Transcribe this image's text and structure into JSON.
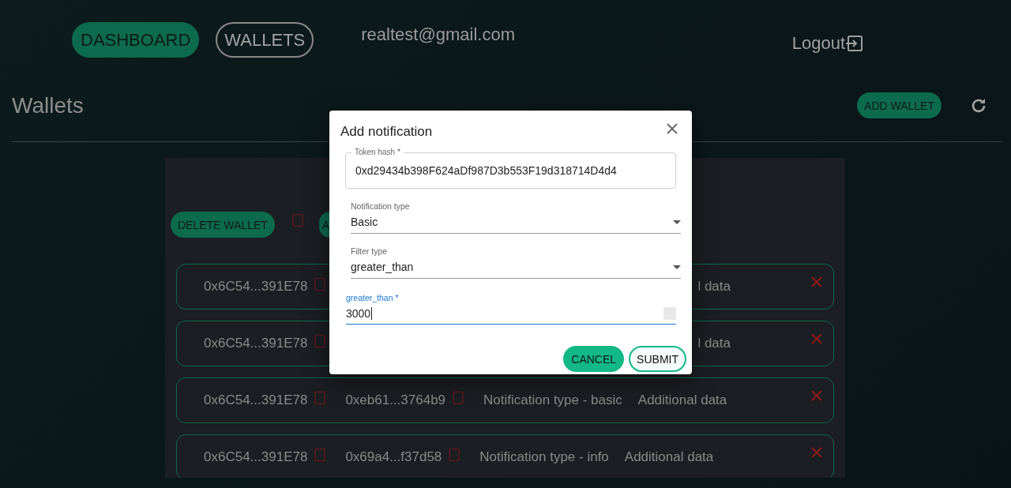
{
  "nav": {
    "buttons": [
      {
        "label": "DASHBOARD",
        "selected": true
      },
      {
        "label": "WALLETS",
        "selected": false
      }
    ],
    "email": "realtest@gmail.com",
    "logout": "Logout"
  },
  "page": {
    "title": "Wallets",
    "add_button": "ADD WALLET"
  },
  "toolbar": {
    "delete_button": "DELETE WALLET",
    "partial_button": "A"
  },
  "rows": [
    {
      "kind": "partial",
      "address": "0x6C54...391E78",
      "extra": "l data"
    },
    {
      "kind": "partial",
      "address": "0x6C54...391E78",
      "extra": "l data"
    },
    {
      "kind": "full",
      "address": "0x6C54...391E78",
      "hash": "0xeb61...3764b9",
      "type": "Notification type - basic",
      "extra": "Additional data"
    },
    {
      "kind": "full",
      "address": "0x6C54...391E78",
      "hash": "0x69a4...f37d58",
      "type": "Notification type - info",
      "extra": "Additional data"
    }
  ],
  "dialog": {
    "title": "Add notification",
    "fields": [
      {
        "kind": "outlined",
        "label": "Token hash *",
        "value": "0xd29434b398F624aDf987D3b553F19d318714D4d4",
        "focused": false
      },
      {
        "kind": "select",
        "label": "Notification type",
        "value": "Basic",
        "focused": false
      },
      {
        "kind": "select",
        "label": "Filter type",
        "value": "greater_than",
        "focused": false
      },
      {
        "kind": "number",
        "label": "greater_than *",
        "value": "3000",
        "focused": true
      }
    ],
    "buttons": [
      {
        "label": "CANCEL",
        "kind": "filled"
      },
      {
        "label": "SUBMIT",
        "kind": "outlined"
      }
    ]
  }
}
